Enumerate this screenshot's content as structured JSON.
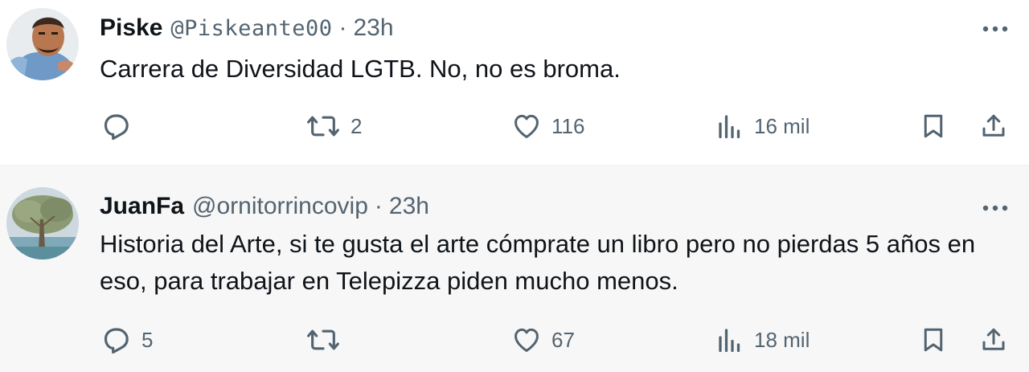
{
  "tweets": [
    {
      "name": "Piske",
      "handle": "@Piskeante00",
      "separator": "·",
      "time": "23h",
      "text": "Carrera de Diversidad LGTB. No, no es broma.",
      "reply_count": "",
      "retweet_count": "2",
      "like_count": "116",
      "views_count": "16 mil"
    },
    {
      "name": "JuanFa",
      "handle": "@ornitorrincovip",
      "separator": "·",
      "time": "23h",
      "text": "Historia del Arte, si te gusta el arte cómprate un libro pero no pierdas 5 años en eso, para trabajar en Telepizza piden mucho menos.",
      "reply_count": "5",
      "retweet_count": "",
      "like_count": "67",
      "views_count": "18 mil"
    }
  ],
  "icons": {
    "reply": "reply-icon",
    "retweet": "retweet-icon",
    "like": "heart-icon",
    "views": "views-icon",
    "bookmark": "bookmark-icon",
    "share": "share-icon",
    "more": "more-icon"
  },
  "colors": {
    "text": "#0f1419",
    "secondary": "#536471",
    "highlight_bg": "#f7f7f7"
  }
}
